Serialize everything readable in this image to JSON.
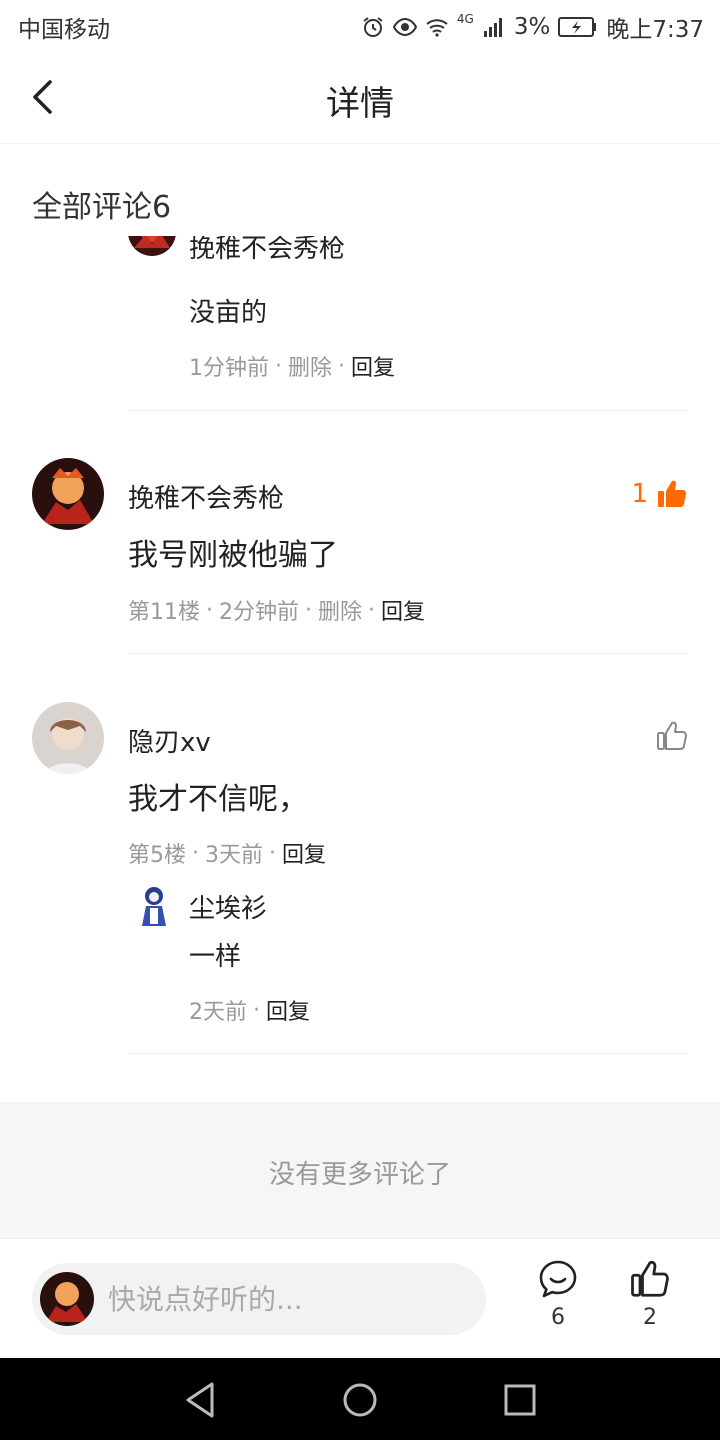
{
  "status_bar": {
    "carrier": "中国移动",
    "network": "4G",
    "battery": "3%",
    "time": "晚上7:37"
  },
  "header": {
    "title": "详情"
  },
  "comments_header": {
    "label": "全部评论6"
  },
  "colors": {
    "accent": "#ff6a00",
    "muted": "#999999",
    "divider": "#eeeeee"
  },
  "partial_reply": {
    "name": "挽稚不会秀枪",
    "text": "没亩的",
    "time": "1分钟前",
    "delete": "删除",
    "reply": "回复"
  },
  "comments": [
    {
      "name": "挽稚不会秀枪",
      "text": "我号刚被他骗了",
      "floor": "第11楼",
      "time": "2分钟前",
      "delete": "删除",
      "reply": "回复",
      "likes": "1",
      "liked": true
    },
    {
      "name": "隐刃xv",
      "text": "我才不信呢，",
      "floor": "第5楼",
      "time": "3天前",
      "reply": "回复",
      "liked": false,
      "sub_reply": {
        "name": "尘埃衫",
        "text": "一样",
        "time": "2天前",
        "reply": "回复"
      }
    }
  ],
  "footer": {
    "no_more": "没有更多评论了"
  },
  "bottom_bar": {
    "placeholder": "快说点好听的...",
    "comment_count": "6",
    "like_count": "2"
  }
}
